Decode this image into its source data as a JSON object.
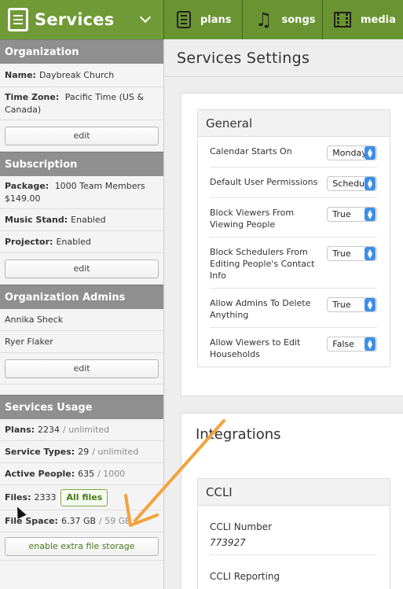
{
  "header": {
    "app_title": "Services",
    "tabs": [
      {
        "label": "plans",
        "icon": "plans-icon"
      },
      {
        "label": "songs",
        "icon": "music-note-icon"
      },
      {
        "label": "media",
        "icon": "film-icon"
      }
    ]
  },
  "sidebar": {
    "organization": {
      "heading": "Organization",
      "name_label": "Name:",
      "name_value": "Daybreak Church",
      "tz_label": "Time Zone:",
      "tz_value": "Pacific Time (US & Canada)",
      "edit_label": "edit"
    },
    "subscription": {
      "heading": "Subscription",
      "package_label": "Package:",
      "package_value": "1000 Team Members",
      "package_price": "$149.00",
      "music_label": "Music Stand:",
      "music_value": "Enabled",
      "projector_label": "Projector:",
      "projector_value": "Enabled",
      "edit_label": "edit"
    },
    "admins": {
      "heading": "Organization Admins",
      "people": [
        "Annika Sheck",
        "Ryer Flaker"
      ],
      "edit_label": "edit"
    },
    "usage": {
      "heading": "Services Usage",
      "plans_label": "Plans:",
      "plans_value": "2234",
      "plans_limit": "/ unlimited",
      "types_label": "Service Types:",
      "types_value": "29",
      "types_limit": "/ unlimited",
      "people_label": "Active People:",
      "people_value": "635",
      "people_limit": "/ 1000",
      "files_label": "Files:",
      "files_value": "2333",
      "all_files_label": "All files",
      "space_label": "File Space:",
      "space_value": "6.37 GB",
      "space_limit": "/ 59 GB",
      "extra_storage_label": "enable extra file storage"
    }
  },
  "main": {
    "title": "Services Settings",
    "general": {
      "heading": "General",
      "settings": [
        {
          "label": "Calendar Starts On",
          "value": "Monday"
        },
        {
          "label": "Default User Permissions",
          "value": "Scheduler"
        },
        {
          "label": "Block Viewers From Viewing People",
          "value": "True"
        },
        {
          "label": "Block Schedulers From Editing People's Contact Info",
          "value": "True"
        },
        {
          "label": "Allow Admins To Delete Anything",
          "value": "True"
        },
        {
          "label": "Allow Viewers to Edit Households",
          "value": "False"
        }
      ]
    },
    "integrations": {
      "heading": "Integrations",
      "ccli": {
        "heading": "CCLI",
        "number_label": "CCLI Number",
        "number_value": "773927",
        "reporting_label": "CCLI Reporting"
      }
    }
  },
  "colors": {
    "header_green": "#6a9432",
    "sidebar_heading": "#8f8f8f",
    "select_arrow": "#3d8fe6",
    "annotation_arrow": "#f2a33a"
  }
}
